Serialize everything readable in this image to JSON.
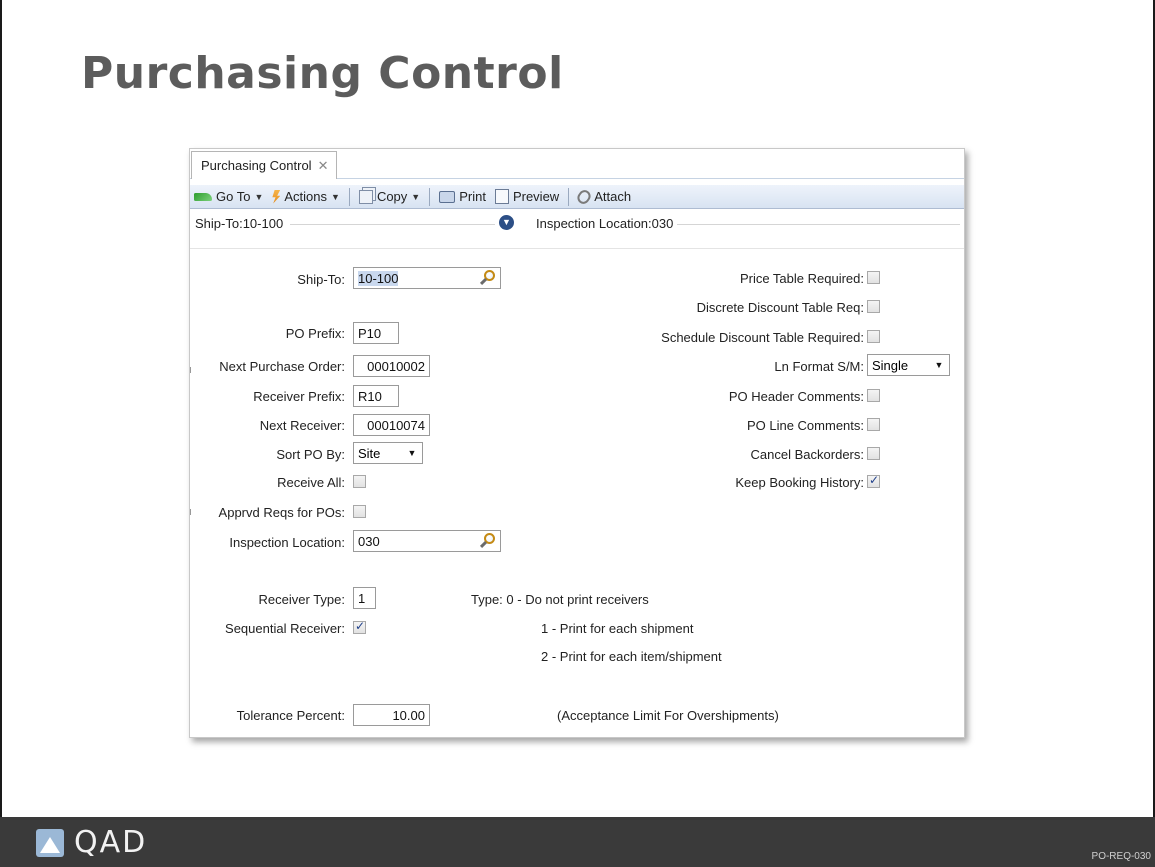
{
  "slide": {
    "title": "Purchasing Control",
    "footer_logo": "QAD",
    "footer_code": "PO-REQ-030"
  },
  "window": {
    "tab_label": "Purchasing Control",
    "tab_close": "✕",
    "toolbar": {
      "goto": "Go To",
      "actions": "Actions",
      "copy": "Copy",
      "print": "Print",
      "preview": "Preview",
      "attach": "Attach"
    },
    "collapse": {
      "left": "Ship-To:10-100",
      "right": "Inspection Location:030"
    }
  },
  "form_left": {
    "ship_to_label": "Ship-To:",
    "ship_to_value": "10-100",
    "po_prefix_label": "PO Prefix:",
    "po_prefix_value": "P10",
    "next_po_label": "Next Purchase Order:",
    "next_po_value": "00010002",
    "receiver_prefix_label": "Receiver Prefix:",
    "receiver_prefix_value": "R10",
    "next_receiver_label": "Next Receiver:",
    "next_receiver_value": "00010074",
    "sort_po_label": "Sort PO By:",
    "sort_po_value": "Site",
    "receive_all_label": "Receive All:",
    "receive_all_checked": false,
    "apprvd_reqs_label": "Apprvd Reqs for POs:",
    "apprvd_reqs_checked": false,
    "inspection_label": "Inspection Location:",
    "inspection_value": "030",
    "receiver_type_label": "Receiver Type:",
    "receiver_type_value": "1",
    "sequential_label": "Sequential Receiver:",
    "sequential_checked": true,
    "tolerance_label": "Tolerance Percent:",
    "tolerance_value": "10.00"
  },
  "form_right": {
    "price_table_label": "Price Table Required:",
    "price_table_checked": false,
    "discrete_label": "Discrete Discount Table Req:",
    "discrete_checked": false,
    "schedule_label": "Schedule Discount Table Required:",
    "schedule_checked": false,
    "ln_format_label": "Ln Format S/M:",
    "ln_format_value": "Single",
    "po_header_label": "PO Header Comments:",
    "po_header_checked": false,
    "po_line_label": "PO Line Comments:",
    "po_line_checked": false,
    "cancel_back_label": "Cancel Backorders:",
    "cancel_back_checked": false,
    "keep_booking_label": "Keep Booking History:",
    "keep_booking_checked": true
  },
  "notes": {
    "type_0": "Type:  0 - Do not print receivers",
    "type_1": "1 - Print for each shipment",
    "type_2": "2 - Print for each item/shipment",
    "tolerance_note": "(Acceptance Limit For Overshipments)"
  },
  "colors": {
    "title": "#5c5c5c",
    "footer_bg": "#3a3a3a",
    "toolbar_top": "#eef3fb",
    "toolbar_bottom": "#d8e3f2",
    "checkmark": "#1f3f8a"
  }
}
